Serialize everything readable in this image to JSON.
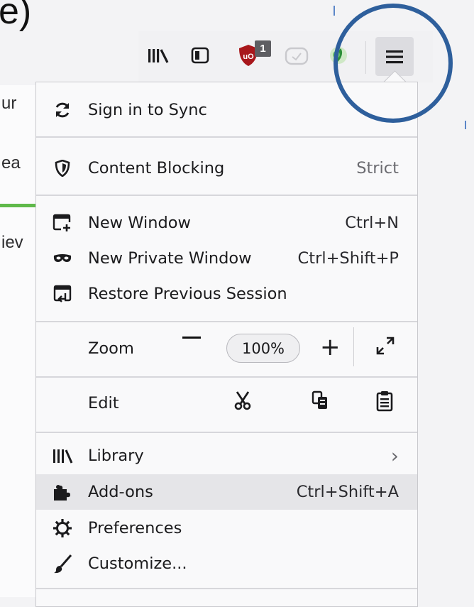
{
  "background": {
    "heading_fragment": "e)",
    "side_fragments": [
      "ur",
      "ea",
      "iev"
    ]
  },
  "toolbar": {
    "icons": [
      "library-icon",
      "sidebar-icon",
      "ublock-origin-icon",
      "screenshot-icon",
      "extension-icon"
    ],
    "ublock_badge": "1",
    "menu_button_icon": "hamburger-menu-icon"
  },
  "menu": {
    "sync": {
      "label": "Sign in to Sync",
      "icon": "sync-icon"
    },
    "content_blocking": {
      "label": "Content Blocking",
      "value": "Strict",
      "icon": "shield-icon"
    },
    "new_window": {
      "label": "New Window",
      "shortcut": "Ctrl+N",
      "icon": "new-window-icon"
    },
    "new_private_window": {
      "label": "New Private Window",
      "shortcut": "Ctrl+Shift+P",
      "icon": "private-mask-icon"
    },
    "restore_session": {
      "label": "Restore Previous Session",
      "icon": "restore-session-icon"
    },
    "zoom": {
      "label": "Zoom",
      "minus": "−",
      "value": "100%",
      "plus": "+",
      "fullscreen_icon": "fullscreen-icon"
    },
    "edit": {
      "label": "Edit",
      "cut_icon": "cut-icon",
      "copy_icon": "copy-icon",
      "paste_icon": "paste-icon"
    },
    "library": {
      "label": "Library",
      "chevron": "›",
      "icon": "library-icon"
    },
    "addons": {
      "label": "Add-ons",
      "shortcut": "Ctrl+Shift+A",
      "icon": "puzzle-icon"
    },
    "preferences": {
      "label": "Preferences",
      "icon": "gear-icon"
    },
    "customize": {
      "label": "Customize...",
      "icon": "paintbrush-icon"
    }
  },
  "colors": {
    "annotation_circle": "#2e5f9c",
    "ublock_red": "#a8171b",
    "green_bar": "#5fb94a",
    "hover_row": "#e5e5e8"
  }
}
